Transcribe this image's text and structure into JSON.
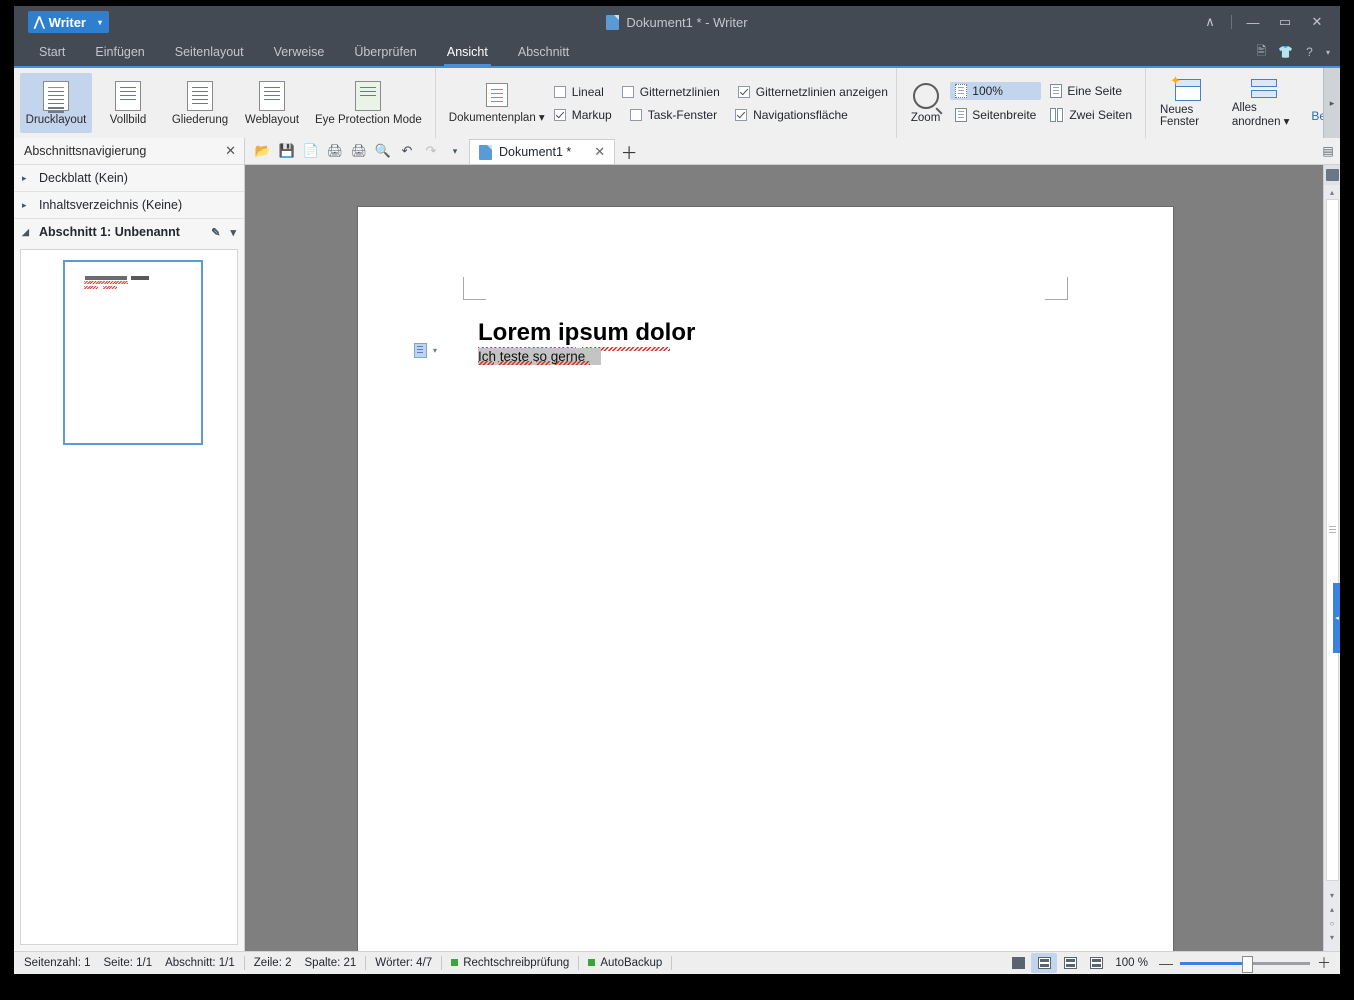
{
  "window": {
    "app_menu_label": "Writer",
    "title": "Dokument1 * - Writer",
    "controls": {
      "collapse": "∧",
      "minimize": "—",
      "maximize": "▭",
      "close": "✕"
    },
    "menu_right_icons": [
      "account-icon",
      "shirt-icon",
      "help-icon"
    ],
    "help_caret": "▾"
  },
  "ribbon_tabs": [
    {
      "label": "Start",
      "active": false
    },
    {
      "label": "Einfügen",
      "active": false
    },
    {
      "label": "Seitenlayout",
      "active": false
    },
    {
      "label": "Verweise",
      "active": false
    },
    {
      "label": "Überprüfen",
      "active": false
    },
    {
      "label": "Ansicht",
      "active": true
    },
    {
      "label": "Abschnitt",
      "active": false
    }
  ],
  "ribbon": {
    "views": [
      {
        "label": "Drucklayout",
        "selected": true
      },
      {
        "label": "Vollbild",
        "selected": false
      },
      {
        "label": "Gliederung",
        "selected": false
      },
      {
        "label": "Weblayout",
        "selected": false
      },
      {
        "label": "Eye Protection Mode",
        "selected": false
      }
    ],
    "document_map": {
      "label": "Dokumentenplan",
      "caret": "▾"
    },
    "checkboxes": [
      {
        "label": "Lineal",
        "checked": false
      },
      {
        "label": "Gitternetzlinien",
        "checked": false
      },
      {
        "label": "Gitternetzlinien anzeigen",
        "checked": true
      },
      {
        "label": "Markup",
        "checked": true
      },
      {
        "label": "Task-Fenster",
        "checked": false
      },
      {
        "label": "Navigationsfläche",
        "checked": true
      }
    ],
    "zoom_group": {
      "zoom_label": "Zoom",
      "percent_label": "100%",
      "percent_selected": true,
      "page_width_label": "Seitenbreite",
      "one_page_label": "Eine Seite",
      "two_pages_label": "Zwei Seiten"
    },
    "window_group": {
      "new_window_label": "Neues Fenster",
      "arrange_all_label": "Alles anordnen",
      "arrange_caret": "▾",
      "truncated_label": "Be"
    },
    "overflow_arrow": "▸"
  },
  "sidebar": {
    "title": "Abschnittsnavigierung",
    "close_icon": "✕",
    "items": [
      {
        "label": "Deckblatt (Kein)",
        "expanded": false,
        "current": false,
        "tri": "▸"
      },
      {
        "label": "Inhaltsverzeichnis (Keine)",
        "expanded": false,
        "current": false,
        "tri": "▸"
      },
      {
        "label": "Abschnitt 1: Unbenannt",
        "expanded": true,
        "current": true,
        "tri": "◢"
      }
    ],
    "section_tools": {
      "edit_icon": "✎",
      "menu_caret": "▾"
    }
  },
  "quick_access": [
    {
      "name": "open-icon",
      "glyph": "📂"
    },
    {
      "name": "save-icon",
      "glyph": "💾"
    },
    {
      "name": "export-pdf-icon",
      "glyph": "📄"
    },
    {
      "name": "print-icon",
      "glyph": "🖨"
    },
    {
      "name": "print-direct-icon",
      "glyph": "🖨"
    },
    {
      "name": "print-preview-icon",
      "glyph": "🔍"
    },
    {
      "name": "undo-icon",
      "glyph": "↶"
    },
    {
      "name": "redo-icon",
      "glyph": "↷"
    },
    {
      "name": "customize-caret-icon",
      "glyph": "▾"
    }
  ],
  "doc_tabs": {
    "tabs": [
      {
        "label": "Dokument1 *",
        "close": "✕",
        "active": true
      }
    ],
    "new_tab": "＋",
    "right_icon": "▤"
  },
  "document": {
    "heading": "Lorem ipsum dolor",
    "paragraph": "Ich teste so gerne",
    "paste_options_caret": "▾"
  },
  "scrollbar": {
    "top_icon": "page-thumbnail-icon",
    "up_arrow": "▴",
    "down_arrow": "▾",
    "prev_page": "▴",
    "select_browse_object": "○",
    "next_page": "▾",
    "collapse_handle": "◂"
  },
  "statusbar": {
    "page_count": "Seitenzahl: 1",
    "page": "Seite: 1/1",
    "section": "Abschnitt: 1/1",
    "line": "Zeile: 2",
    "column": "Spalte: 21",
    "words": "Wörter: 4/7",
    "spellcheck": "Rechtschreibprüfung",
    "autobackup": "AutoBackup",
    "status_dot_color": "#3aa63a",
    "view_buttons": [
      {
        "name": "fullscreen-view-button",
        "selected": false
      },
      {
        "name": "print-layout-view-button",
        "selected": true
      },
      {
        "name": "outline-view-button",
        "selected": false
      },
      {
        "name": "web-layout-view-button",
        "selected": false
      }
    ],
    "zoom_percent": "100 %",
    "zoom_minus": "—",
    "zoom_plus": "＋"
  }
}
